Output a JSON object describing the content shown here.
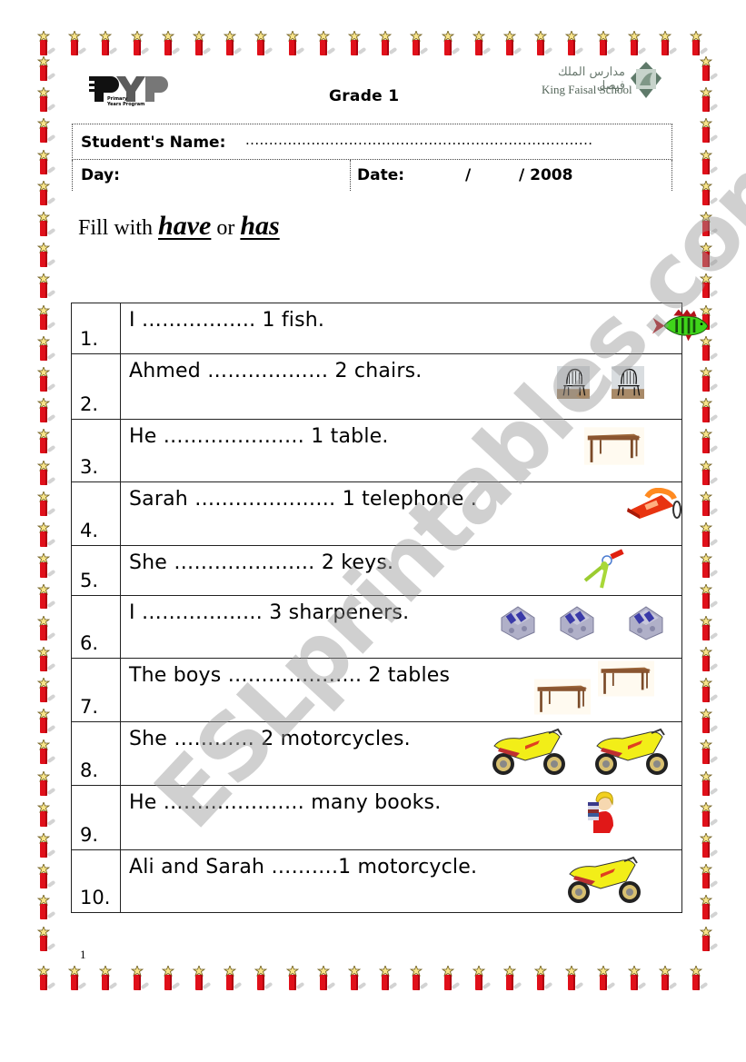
{
  "header": {
    "logo_left": {
      "big_text": "PYP",
      "small_line1": "Primary",
      "small_line2": "Years Program"
    },
    "grade": "Grade 1",
    "logo_right": {
      "arabic": "مدارس الملك فيصل",
      "english": "King Faisal School"
    }
  },
  "info": {
    "student_name_label": "Student's Name:",
    "student_name_value": "..........................................................................",
    "day_label": "Day:",
    "date_label": "Date:",
    "date_slash": "/",
    "date_year": "/ 2008"
  },
  "instruction": {
    "prefix": "Fill with ",
    "option1": "have",
    "middle": " or ",
    "option2": "has"
  },
  "exercises": [
    {
      "number": "1.",
      "sentence": "I …………….. 1 fish.",
      "pictures": [
        "fish"
      ]
    },
    {
      "number": "2.",
      "sentence": "Ahmed ……………… 2 chairs.",
      "pictures": [
        "chair",
        "chair"
      ]
    },
    {
      "number": "3.",
      "sentence": "He ………………… 1 table.",
      "pictures": [
        "table"
      ]
    },
    {
      "number": "4.",
      "sentence": "Sarah ………………… 1 telephone .",
      "pictures": [
        "telephone"
      ]
    },
    {
      "number": "5.",
      "sentence": "She …………………  2 keys.",
      "pictures": [
        "keys"
      ]
    },
    {
      "number": "6.",
      "sentence": "I ……………… 3 sharpeners.",
      "pictures": [
        "sharpener",
        "sharpener",
        "sharpener"
      ]
    },
    {
      "number": "7.",
      "sentence": "The boys ……………….. 2 tables",
      "pictures": [
        "table",
        "table"
      ]
    },
    {
      "number": "8.",
      "sentence": "She ………… 2 motorcycles.",
      "pictures": [
        "motorcycle",
        "motorcycle"
      ]
    },
    {
      "number": "9.",
      "sentence": "He ………………… many books.",
      "pictures": [
        "boy-with-books"
      ]
    },
    {
      "number": "10.",
      "sentence": "Ali and Sarah ……….1 motorcycle.",
      "pictures": [
        "motorcycle"
      ]
    }
  ],
  "watermark": "ESLprintables.com",
  "footer": {
    "page_number": "1"
  },
  "colors": {
    "cracker_red": "#e0101a",
    "text": "#000000",
    "watermark": "#969696"
  }
}
